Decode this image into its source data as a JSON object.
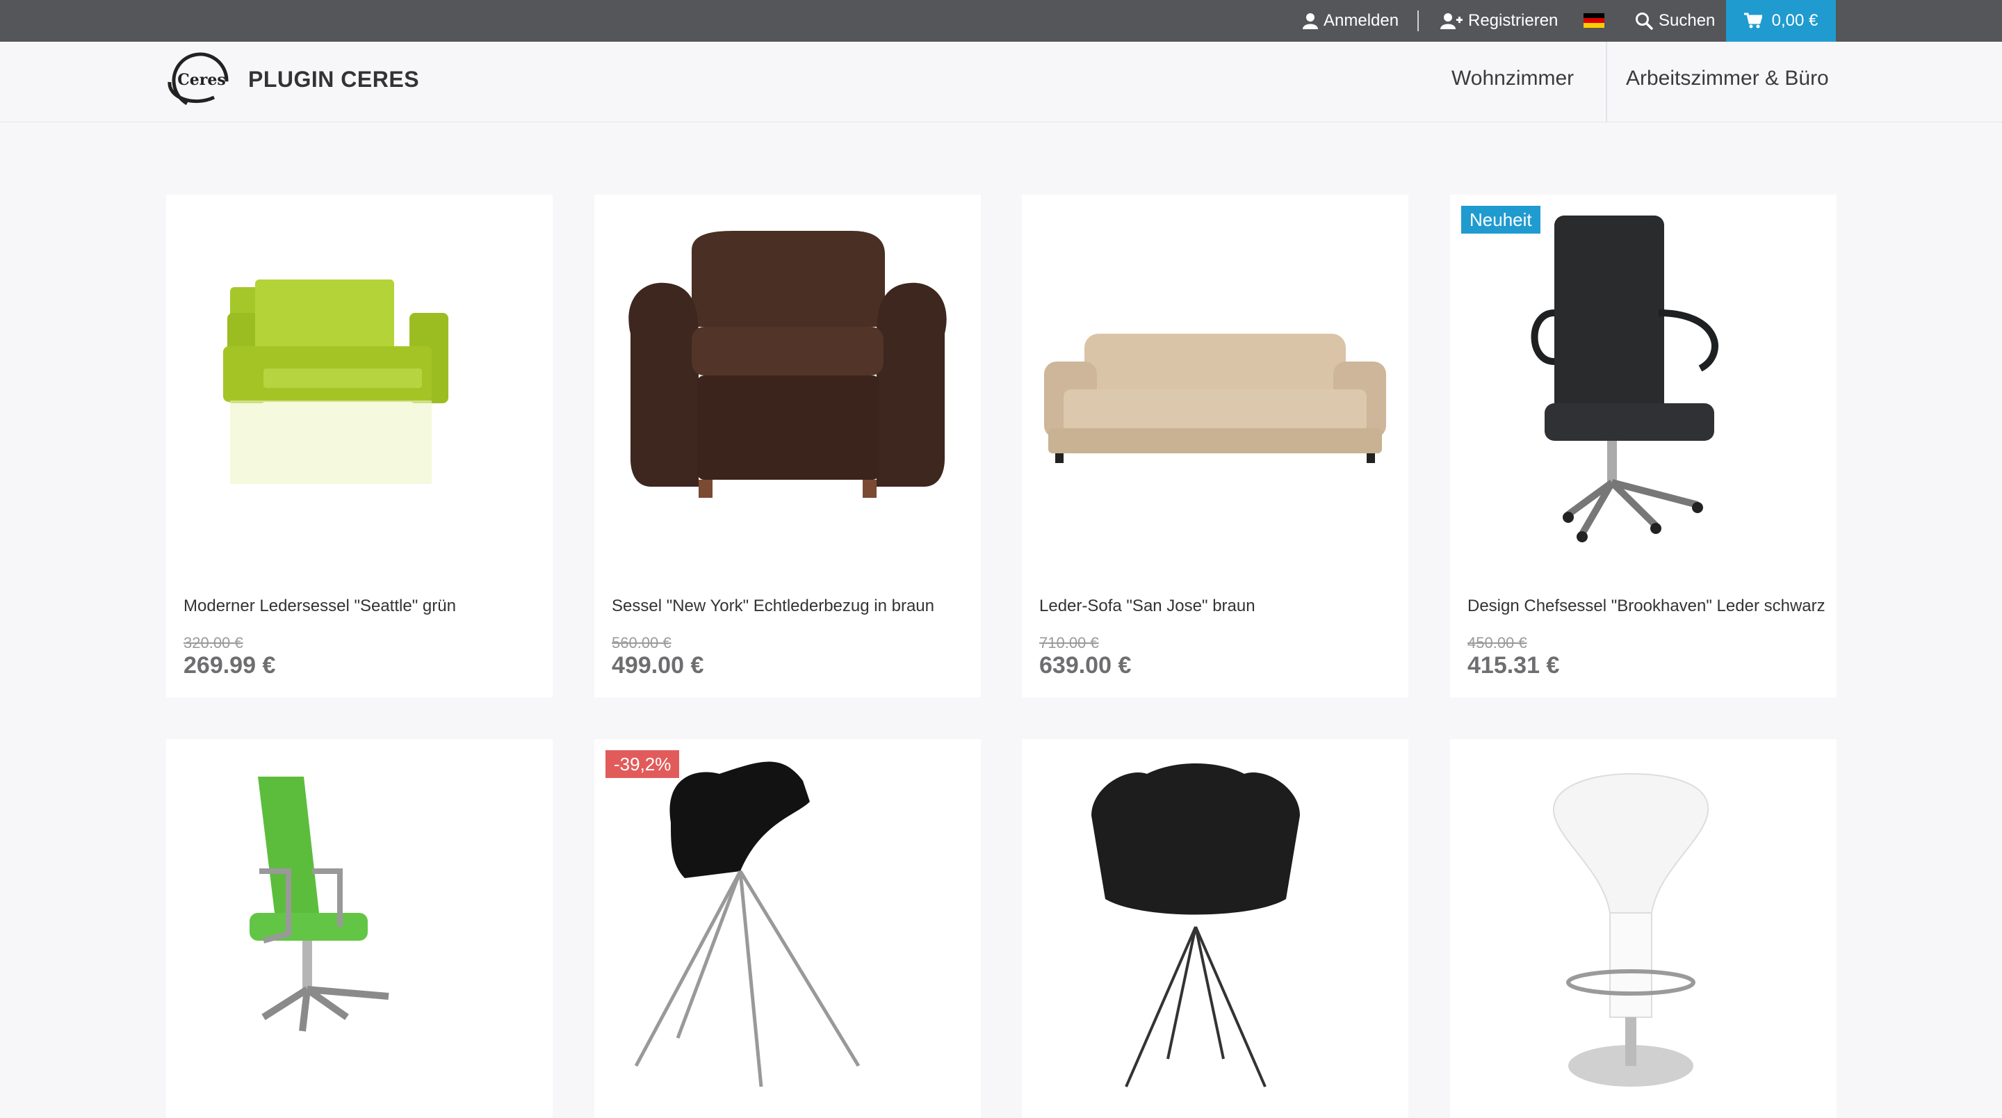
{
  "topbar": {
    "login_label": "Anmelden",
    "register_label": "Registrieren",
    "search_label": "Suchen",
    "cart_total": "0,00 €",
    "language_flag": "flag-germany-icon"
  },
  "header": {
    "logo_text": "Ceres",
    "brand": "PLUGIN CERES",
    "nav": [
      {
        "label": "Wohnzimmer"
      },
      {
        "label": "Arbeitszimmer & Büro"
      }
    ]
  },
  "products": [
    {
      "name": "Moderner Ledersessel \"Seattle\" grün",
      "old_price": "320.00 €",
      "price": "269.99 €",
      "badge": ""
    },
    {
      "name": "Sessel \"New York\" Echtlederbezug in braun",
      "old_price": "560.00 €",
      "price": "499.00 €",
      "badge": ""
    },
    {
      "name": "Leder-Sofa \"San Jose\" braun",
      "old_price": "710.00 €",
      "price": "639.00 €",
      "badge": ""
    },
    {
      "name": "Design Chefsessel \"Brookhaven\" Leder schwarz",
      "old_price": "450.00 €",
      "price": "415.31 €",
      "badge": "Neuheit"
    },
    {
      "name": "",
      "old_price": "",
      "price": "",
      "badge": ""
    },
    {
      "name": "",
      "old_price": "",
      "price": "",
      "badge": "-39,2%"
    },
    {
      "name": "",
      "old_price": "",
      "price": "",
      "badge": ""
    },
    {
      "name": "",
      "old_price": "",
      "price": "",
      "badge": ""
    }
  ],
  "colors": {
    "topbar": "#54565a",
    "accent": "#1f9bd0",
    "new_badge": "#1f9bd0",
    "sale_badge": "#e25b5b"
  }
}
